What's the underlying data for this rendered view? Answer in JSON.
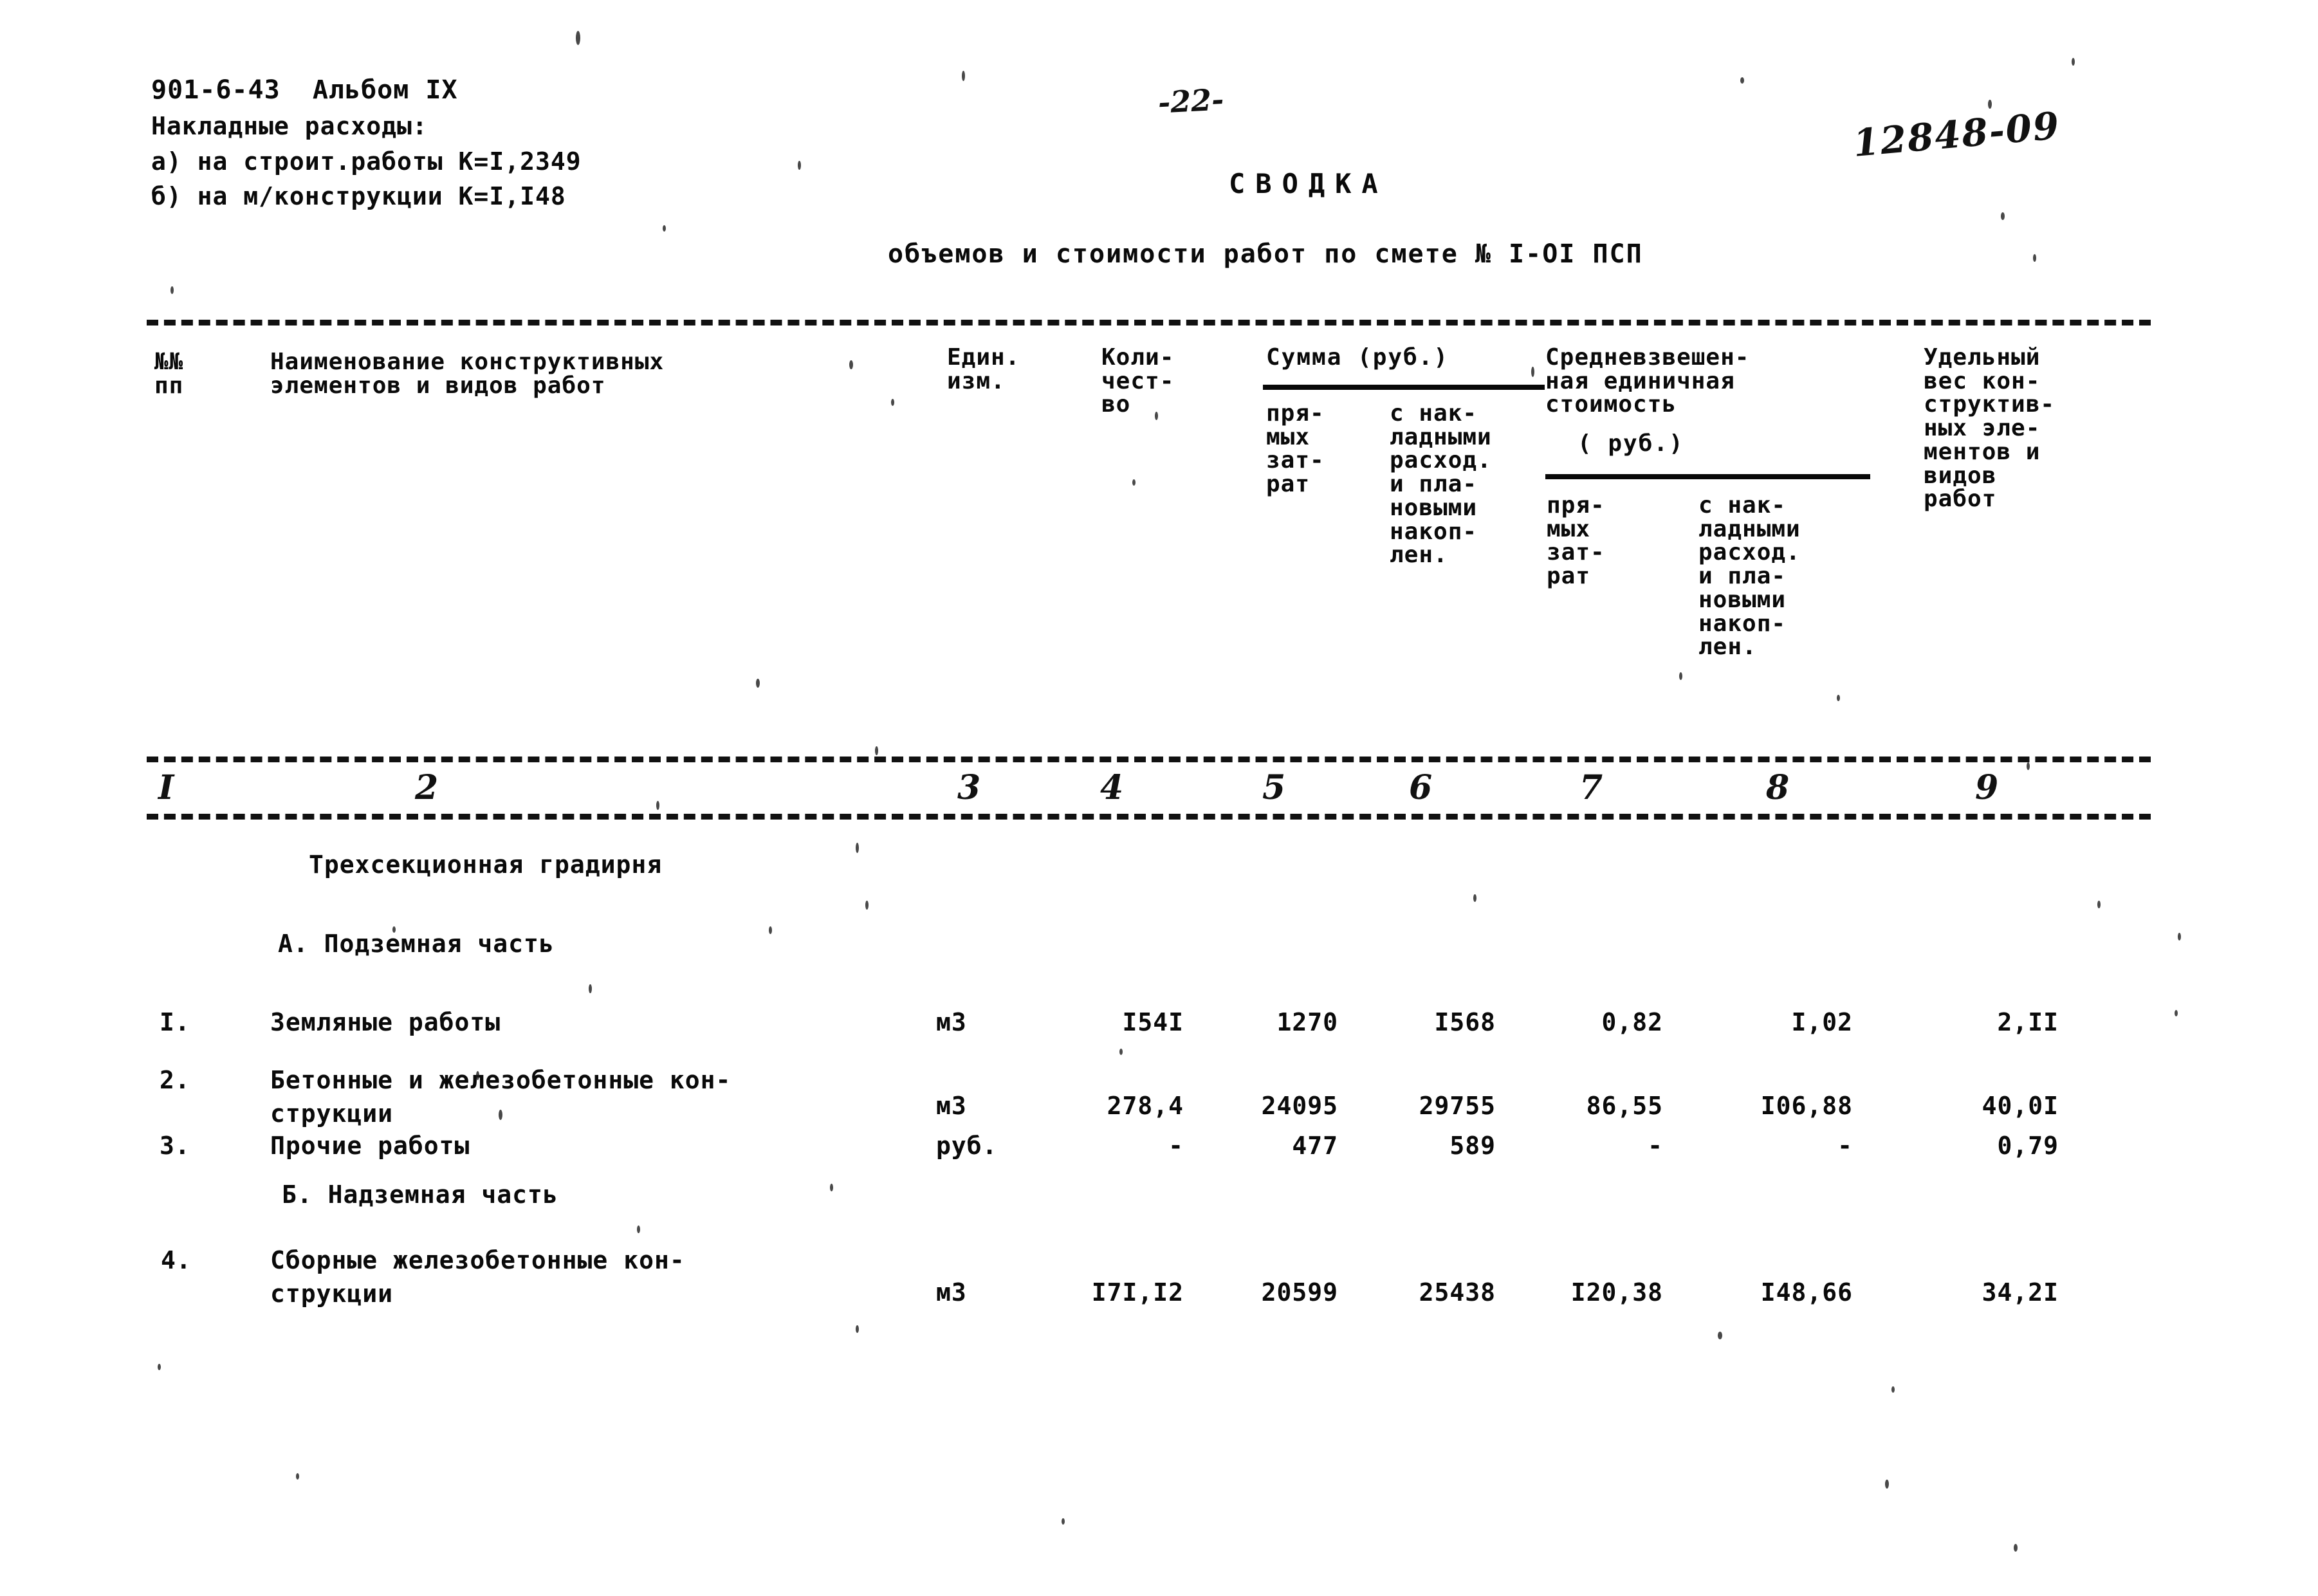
{
  "document": {
    "album_code": "901-6-43  Альбом IX",
    "overhead_label": "Накладные расходы:",
    "overhead_a": "а) на строит.работы К=I,2349",
    "overhead_b": "б) на м/конструкции К=I,I48",
    "page_number": "-22-",
    "archive_number": "12848-09",
    "title": "СВОДКА",
    "subtitle": "объемов и стоимости работ по смете № I-OI ПСП"
  },
  "table": {
    "headers": {
      "no_line1": "№№",
      "no_line2": "пп",
      "name_line1": "Наименование конструктивных",
      "name_line2": "элементов и видов работ",
      "unit_line1": "Един.",
      "unit_line2": "изм.",
      "qty_line1": "Коли-",
      "qty_line2": "чест-",
      "qty_line3": "во",
      "summa_group": "Сумма (руб.)",
      "col5": "пря-\nмых\nзат-\nрат",
      "col6": "с нак-\nладными\nрасход.\nи пла-\nновыми\nнакоп-\nлен.",
      "sred_line1": "Средневзвешен-",
      "sred_line2": "ная единичная",
      "sred_line3": "стоимость",
      "sred_rub": "( руб.)",
      "col7": "пря-\nмых\nзат-\nрат",
      "col8": "с нак-\nладными\nрасход.\nи пла-\nновыми\nнакоп-\nлен.",
      "col9": "Удельный\nвес кон-\nструктив-\nных эле-\nментов и\nвидов\nработ"
    },
    "column_numbers": [
      "I",
      "2",
      "3",
      "4",
      "5",
      "6",
      "7",
      "8",
      "9"
    ],
    "section_title": "Трехсекционная градирня",
    "section_a": "А. Подземная часть",
    "section_b": "Б. Надземная часть",
    "rows": [
      {
        "num": "I.",
        "label_line1": "Земляные работы",
        "label_line2": "",
        "unit": "м3",
        "qty": "I54I",
        "c5": "1270",
        "c6": "I568",
        "c7": "0,82",
        "c8": "I,02",
        "c9": "2,II"
      },
      {
        "num": "2.",
        "label_line1": "Бетонные и железобетонные кон-",
        "label_line2": "струкции",
        "unit": "м3",
        "qty": "278,4",
        "c5": "24095",
        "c6": "29755",
        "c7": "86,55",
        "c8": "I06,88",
        "c9": "40,0I"
      },
      {
        "num": "З.",
        "label_line1": "Прочие работы",
        "label_line2": "",
        "unit": "руб.",
        "qty": "-",
        "c5": "477",
        "c6": "589",
        "c7": "-",
        "c8": "-",
        "c9": "0,79"
      },
      {
        "num": "4.",
        "label_line1": "Сборные железобетонные кон-",
        "label_line2": "струкции",
        "unit": "м3",
        "qty": "I7I,I2",
        "c5": "20599",
        "c6": "25438",
        "c7": "I20,38",
        "c8": "I48,66",
        "c9": "34,2I"
      }
    ]
  }
}
